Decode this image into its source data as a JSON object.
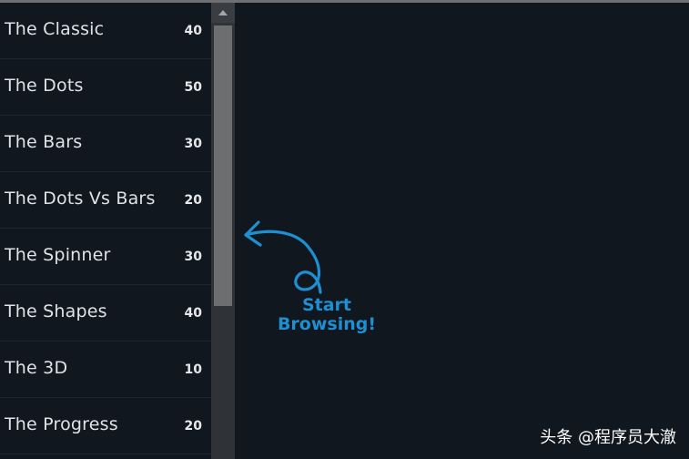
{
  "sidebar": {
    "items": [
      {
        "label": "The Classic",
        "count": "40"
      },
      {
        "label": "The Dots",
        "count": "50"
      },
      {
        "label": "The Bars",
        "count": "30"
      },
      {
        "label": "The Dots Vs Bars",
        "count": "20"
      },
      {
        "label": "The Spinner",
        "count": "30"
      },
      {
        "label": "The Shapes",
        "count": "40"
      },
      {
        "label": "The 3D",
        "count": "10"
      },
      {
        "label": "The Progress",
        "count": "20"
      }
    ]
  },
  "main": {
    "hint_line1": "Start",
    "hint_line2": "Browsing!",
    "hint_icon": "curly-arrow-icon"
  },
  "watermark": {
    "text": "头条 @程序员大澈"
  },
  "colors": {
    "background": "#11171f",
    "accent": "#1e8fd0",
    "scrollbar_thumb": "#6c6e70"
  }
}
